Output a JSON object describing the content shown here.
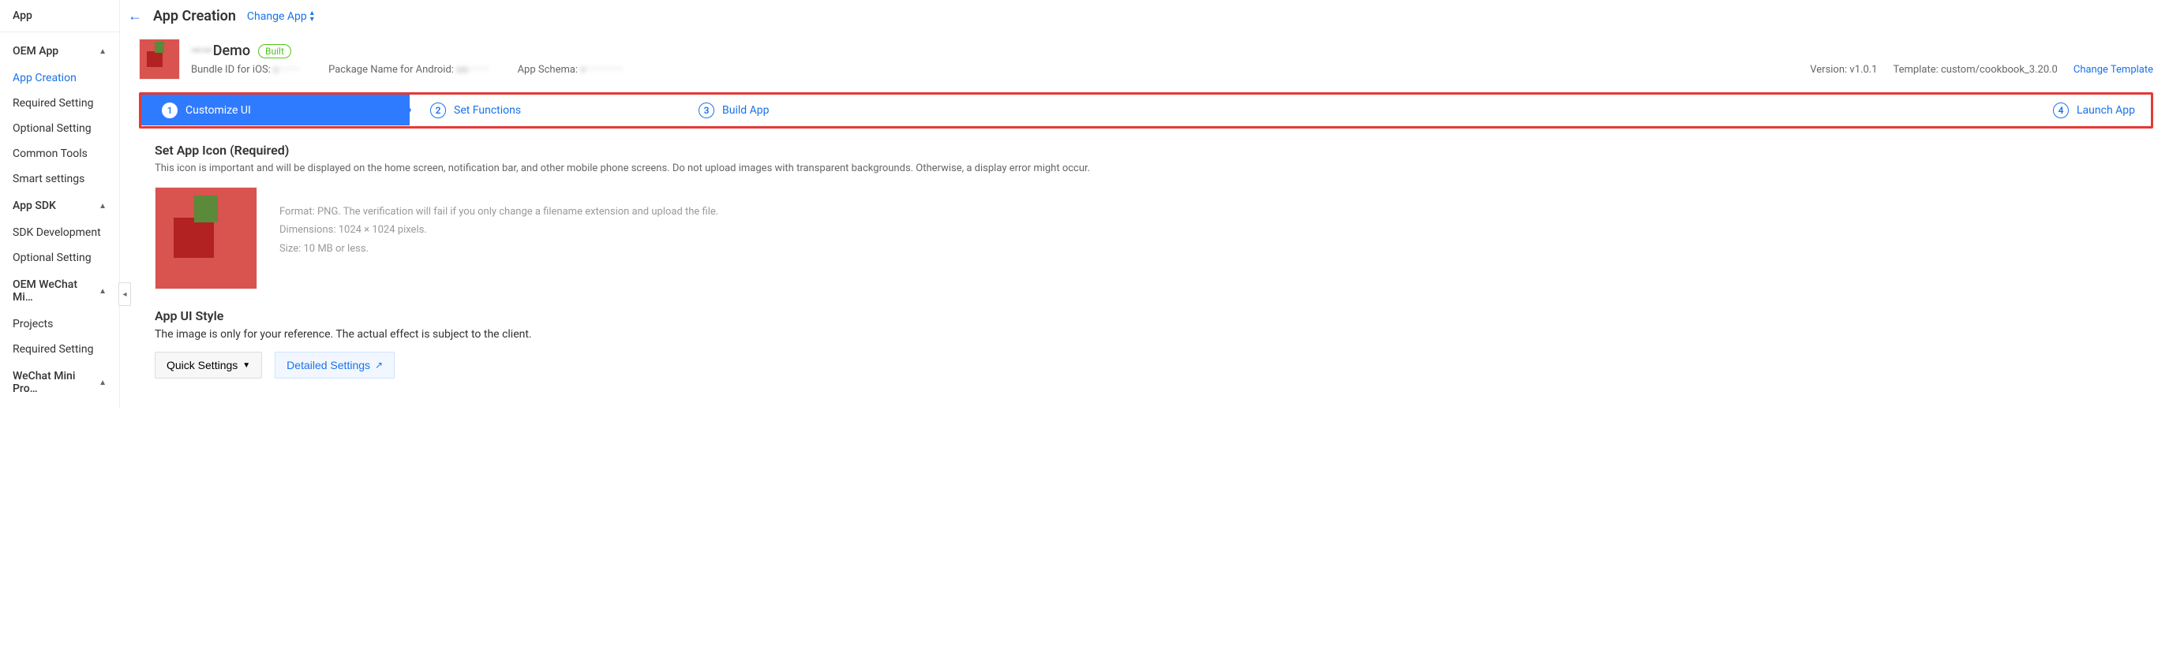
{
  "sidebar": {
    "top_label": "App",
    "groups": [
      {
        "label": "OEM App",
        "expanded": true,
        "items": [
          {
            "label": "App Creation",
            "active": true
          },
          {
            "label": "Required Setting"
          },
          {
            "label": "Optional Setting"
          },
          {
            "label": "Common Tools"
          },
          {
            "label": "Smart settings"
          }
        ]
      },
      {
        "label": "App SDK",
        "expanded": true,
        "items": [
          {
            "label": "SDK Development"
          },
          {
            "label": "Optional Setting"
          }
        ]
      },
      {
        "label": "OEM WeChat Mi…",
        "expanded": true,
        "items": [
          {
            "label": "Projects"
          },
          {
            "label": "Required Setting"
          }
        ]
      },
      {
        "label": "WeChat Mini Pro…",
        "expanded": true,
        "items": []
      }
    ]
  },
  "header": {
    "title": "App Creation",
    "change_app": "Change App"
  },
  "app": {
    "name_prefix_masked": "——",
    "name": "Demo",
    "status_badge": "Built",
    "bundle_label": "Bundle ID for iOS:",
    "bundle_value_masked": "c········",
    "package_label": "Package Name for Android:",
    "package_value_masked": "co········",
    "schema_label": "App Schema:",
    "schema_value_masked": "v··············",
    "version_label": "Version:",
    "version_value": "v1.0.1",
    "template_label": "Template:",
    "template_value": "custom/cookbook_3.20.0",
    "change_template": "Change Template"
  },
  "steps": [
    {
      "n": "1",
      "label": "Customize UI",
      "active": true
    },
    {
      "n": "2",
      "label": "Set Functions"
    },
    {
      "n": "3",
      "label": "Build App"
    },
    {
      "n": "4",
      "label": "Launch App"
    }
  ],
  "icon_section": {
    "title": "Set App Icon (Required)",
    "desc": "This icon is important and will be displayed on the home screen, notification bar, and other mobile phone screens. Do not upload images with transparent backgrounds. Otherwise, a display error might occur.",
    "hint_format": "Format: PNG. The verification will fail if you only change a filename extension and upload the file.",
    "hint_dim": "Dimensions: 1024 × 1024 pixels.",
    "hint_size": "Size: 10 MB or less."
  },
  "ui_style": {
    "title": "App UI Style",
    "desc": "The image is only for your reference. The actual effect is subject to the client.",
    "quick_label": "Quick Settings",
    "detailed_label": "Detailed Settings"
  }
}
